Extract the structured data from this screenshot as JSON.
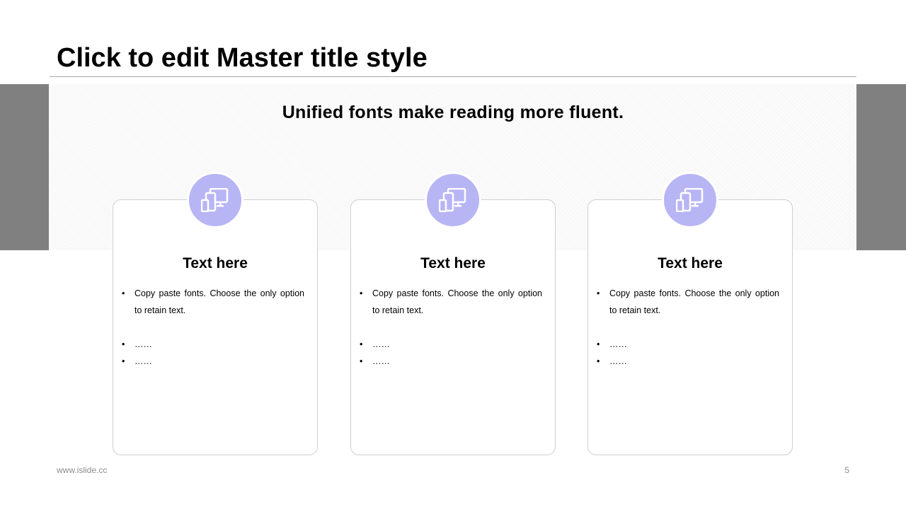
{
  "slide": {
    "title": "Click to edit Master title style",
    "subtitle": "Unified fonts make reading more fluent.",
    "accent_color": "#b8b5f5",
    "band_color": "#808080"
  },
  "cards": [
    {
      "icon": "devices-icon",
      "heading": "Text here",
      "bullets": [
        "Copy paste fonts. Choose the only option to retain text.",
        "……",
        "……"
      ]
    },
    {
      "icon": "devices-icon",
      "heading": "Text here",
      "bullets": [
        "Copy paste fonts. Choose the only option to retain text.",
        "……",
        "……"
      ]
    },
    {
      "icon": "devices-icon",
      "heading": "Text here",
      "bullets": [
        "Copy paste fonts. Choose the only option to retain text.",
        "……",
        "……"
      ]
    }
  ],
  "footer": {
    "url": "www.islide.cc",
    "page_number": "5"
  }
}
